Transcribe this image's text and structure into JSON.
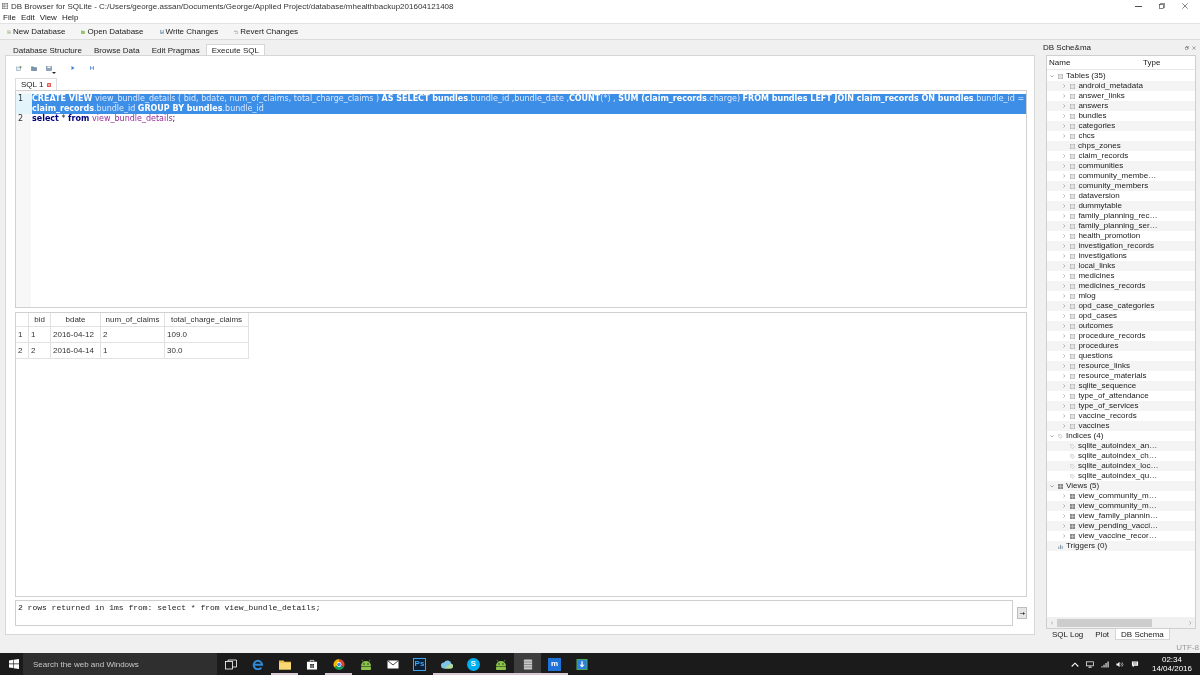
{
  "window": {
    "title": "DB Browser for SQLite - C:/Users/george.assan/Documents/George/Applied Project/database/mhealthbackup201604121408"
  },
  "menu": [
    "File",
    "Edit",
    "View",
    "Help"
  ],
  "toolbar": [
    {
      "kind": "new",
      "label": "New Database"
    },
    {
      "kind": "open",
      "label": "Open Database"
    },
    {
      "kind": "write",
      "label": "Write Changes"
    },
    {
      "kind": "revert",
      "label": "Revert Changes"
    }
  ],
  "tabs": [
    {
      "label": "Database Structure",
      "selected": false
    },
    {
      "label": "Browse Data",
      "selected": false
    },
    {
      "label": "Edit Pragmas",
      "selected": false
    },
    {
      "label": "Execute SQL",
      "selected": true
    }
  ],
  "editor": {
    "tabs": [
      {
        "label": "SQL 1",
        "selected": true
      }
    ],
    "lines": [
      {
        "number": "1",
        "selected": true,
        "tokens": [
          {
            "kind": "keyword",
            "text": "CREATE VIEW "
          },
          {
            "kind": "identifier",
            "text": "view_bundle_details ( bid, bdate, num_of_claims, total_charge_claims ) "
          },
          {
            "kind": "keyword",
            "text": "AS SELECT bundles"
          },
          {
            "kind": "identifier",
            "text": ".bundle_id ,bundle_date ,"
          },
          {
            "kind": "keyword",
            "text": "COUNT"
          },
          {
            "kind": "identifier",
            "text": "(*) , "
          },
          {
            "kind": "keyword",
            "text": "SUM (claim_records"
          },
          {
            "kind": "identifier",
            "text": ".charge) "
          },
          {
            "kind": "keyword",
            "text": "FROM bundles LEFT JOIN claim_records ON bundles"
          },
          {
            "kind": "identifier",
            "text": ".bundle_id = "
          },
          {
            "kind": "keyword",
            "text": "claim_records"
          },
          {
            "kind": "identifier",
            "text": ".bundle_id "
          },
          {
            "kind": "keyword",
            "text": "GROUP BY bundles"
          },
          {
            "kind": "identifier",
            "text": ".bundle_id"
          }
        ]
      },
      {
        "number": "2",
        "selected": false,
        "tokens": [
          {
            "kind": "keyword",
            "text": "select"
          },
          {
            "kind": "plain",
            "text": " * "
          },
          {
            "kind": "keyword",
            "text": "from "
          },
          {
            "kind": "identifier",
            "text": "view_bundle_details"
          },
          {
            "kind": "plain",
            "text": ";"
          }
        ]
      }
    ]
  },
  "results": {
    "columns": [
      "bid",
      "bdate",
      "num_of_claims",
      "total_charge_claims"
    ],
    "rows": [
      {
        "header": "1",
        "cells": [
          "1",
          "2016-04-12",
          "2",
          "109.0"
        ]
      },
      {
        "header": "2",
        "cells": [
          "2",
          "2016-04-14",
          "1",
          "30.0"
        ]
      }
    ],
    "message": "2 rows returned in 1ms from: select * from view_bundle_details;"
  },
  "schema": {
    "title": "DB Sche&ma",
    "columns": [
      "Name",
      "Type"
    ],
    "tree": [
      {
        "label": "Tables (35)",
        "kind": "table",
        "expandable": true,
        "expanded": true,
        "children": [
          {
            "label": "android_metadata",
            "kind": "table",
            "expandable": true,
            "expanded": false
          },
          {
            "label": "answer_links",
            "kind": "table",
            "expandable": true,
            "expanded": false
          },
          {
            "label": "answers",
            "kind": "table",
            "expandable": true,
            "expanded": false
          },
          {
            "label": "bundles",
            "kind": "table",
            "expandable": true,
            "expanded": false
          },
          {
            "label": "categories",
            "kind": "table",
            "expandable": true,
            "expanded": false
          },
          {
            "label": "chcs",
            "kind": "table",
            "expandable": true,
            "expanded": false
          },
          {
            "label": "chps_zones",
            "kind": "table",
            "expandable": false
          },
          {
            "label": "claim_records",
            "kind": "table",
            "expandable": true,
            "expanded": false
          },
          {
            "label": "communities",
            "kind": "table",
            "expandable": true,
            "expanded": false
          },
          {
            "label": "community_membe…",
            "kind": "table",
            "expandable": true,
            "expanded": false
          },
          {
            "label": "comunity_members",
            "kind": "table",
            "expandable": true,
            "expanded": false
          },
          {
            "label": "dataversion",
            "kind": "table",
            "expandable": true,
            "expanded": false
          },
          {
            "label": "dummytable",
            "kind": "table",
            "expandable": true,
            "expanded": false
          },
          {
            "label": "family_planning_rec…",
            "kind": "table",
            "expandable": true,
            "expanded": false
          },
          {
            "label": "family_planning_ser…",
            "kind": "table",
            "expandable": true,
            "expanded": false
          },
          {
            "label": "health_promotion",
            "kind": "table",
            "expandable": true,
            "expanded": false
          },
          {
            "label": "investigation_records",
            "kind": "table",
            "expandable": true,
            "expanded": false
          },
          {
            "label": "investigations",
            "kind": "table",
            "expandable": true,
            "expanded": false
          },
          {
            "label": "local_links",
            "kind": "table",
            "expandable": true,
            "expanded": false
          },
          {
            "label": "medicines",
            "kind": "table",
            "expandable": true,
            "expanded": false
          },
          {
            "label": "medicines_records",
            "kind": "table",
            "expandable": true,
            "expanded": false
          },
          {
            "label": "mlog",
            "kind": "table",
            "expandable": true,
            "expanded": false
          },
          {
            "label": "opd_case_categories",
            "kind": "table",
            "expandable": true,
            "expanded": false
          },
          {
            "label": "opd_cases",
            "kind": "table",
            "expandable": true,
            "expanded": false
          },
          {
            "label": "outcomes",
            "kind": "table",
            "expandable": true,
            "expanded": false
          },
          {
            "label": "procedure_records",
            "kind": "table",
            "expandable": true,
            "expanded": false
          },
          {
            "label": "procedures",
            "kind": "table",
            "expandable": true,
            "expanded": false
          },
          {
            "label": "questions",
            "kind": "table",
            "expandable": true,
            "expanded": false
          },
          {
            "label": "resource_links",
            "kind": "table",
            "expandable": true,
            "expanded": false
          },
          {
            "label": "resource_materials",
            "kind": "table",
            "expandable": true,
            "expanded": false
          },
          {
            "label": "sqlite_sequence",
            "kind": "table",
            "expandable": true,
            "expanded": false
          },
          {
            "label": "type_of_attendance",
            "kind": "table",
            "expandable": true,
            "expanded": false
          },
          {
            "label": "type_of_services",
            "kind": "table",
            "expandable": true,
            "expanded": false
          },
          {
            "label": "vaccine_records",
            "kind": "table",
            "expandable": true,
            "expanded": false
          },
          {
            "label": "vaccines",
            "kind": "table",
            "expandable": true,
            "expanded": false
          }
        ]
      },
      {
        "label": "Indices (4)",
        "kind": "index",
        "expandable": true,
        "expanded": true,
        "children": [
          {
            "label": "sqlite_autoindex_an…",
            "kind": "index",
            "expandable": false
          },
          {
            "label": "sqlite_autoindex_ch…",
            "kind": "index",
            "expandable": false
          },
          {
            "label": "sqlite_autoindex_loc…",
            "kind": "index",
            "expandable": false
          },
          {
            "label": "sqlite_autoindex_qu…",
            "kind": "index",
            "expandable": false
          }
        ]
      },
      {
        "label": "Views (5)",
        "kind": "view",
        "expandable": true,
        "expanded": true,
        "children": [
          {
            "label": "view_community_m…",
            "kind": "view",
            "expandable": true,
            "expanded": false
          },
          {
            "label": "view_community_m…",
            "kind": "view",
            "expandable": true,
            "expanded": false
          },
          {
            "label": "view_family_plannin…",
            "kind": "view",
            "expandable": true,
            "expanded": false
          },
          {
            "label": "view_pending_vacci…",
            "kind": "view",
            "expandable": true,
            "expanded": false
          },
          {
            "label": "view_vaccine_recor…",
            "kind": "view",
            "expandable": true,
            "expanded": false
          }
        ]
      },
      {
        "label": "Triggers (0)",
        "kind": "trigger",
        "expandable": false
      }
    ]
  },
  "dock_tabs": [
    {
      "label": "SQL Log",
      "selected": false
    },
    {
      "label": "Plot",
      "selected": false
    },
    {
      "label": "DB Schema",
      "selected": true
    }
  ],
  "status_bar": {
    "encoding": "UTF-8"
  },
  "taskbar": {
    "search": {
      "placeholder": "Search the web and Windows"
    },
    "apps": [
      {
        "kind": "task-view",
        "active": false,
        "running": false
      },
      {
        "kind": "e-logo",
        "active": false,
        "running": false
      },
      {
        "kind": "folder",
        "active": false,
        "running": true
      },
      {
        "kind": "bag",
        "active": false,
        "running": false
      },
      {
        "kind": "wheel",
        "active": false,
        "running": true
      },
      {
        "kind": "robot",
        "active": false,
        "running": false
      },
      {
        "kind": "envelope",
        "active": false,
        "running": false
      },
      {
        "kind": "tile-ps",
        "glyph": "Ps",
        "active": false,
        "running": false
      },
      {
        "kind": "cloud",
        "active": false,
        "running": true
      },
      {
        "kind": "tile-round",
        "glyph": "S",
        "active": false,
        "running": true
      },
      {
        "kind": "robot",
        "active": false,
        "running": true
      },
      {
        "kind": "database",
        "active": true,
        "running": true
      },
      {
        "kind": "tile-m",
        "glyph": "m",
        "active": false,
        "running": true
      },
      {
        "kind": "download",
        "active": false,
        "running": false
      }
    ],
    "time": "02:34",
    "date": "14/04/2016"
  }
}
